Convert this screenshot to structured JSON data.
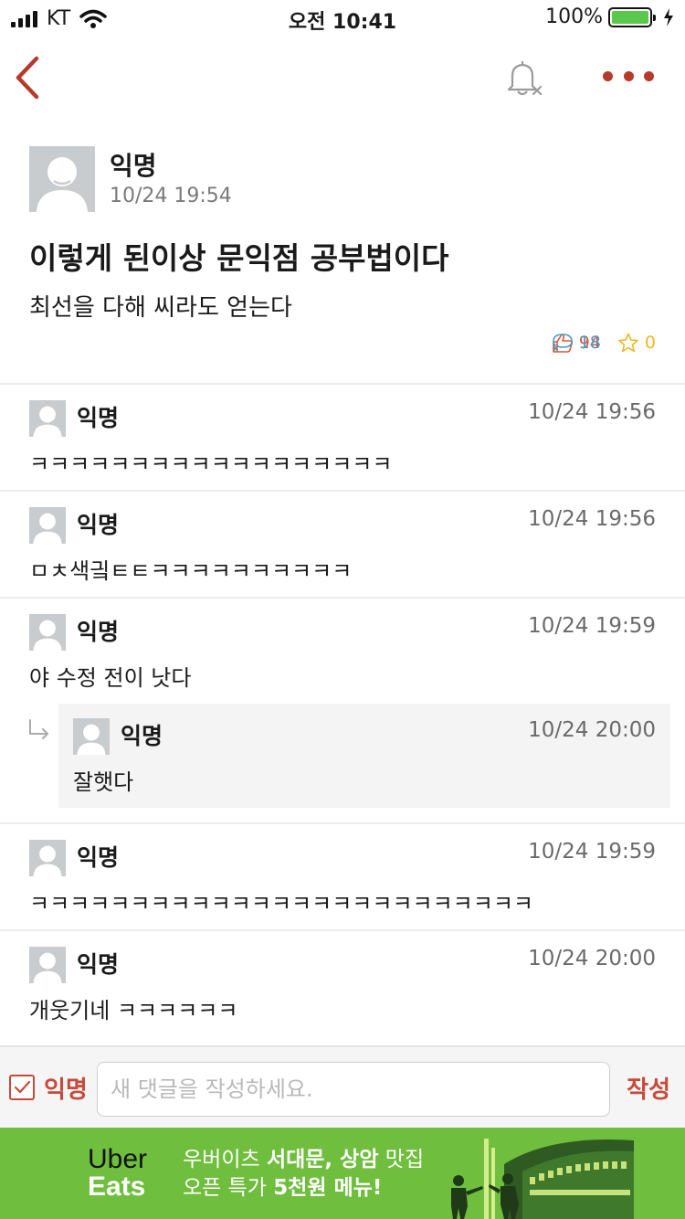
{
  "status_bar": {
    "carrier": "KT",
    "time": "오전 10:41",
    "battery": "100%"
  },
  "nav": {
    "back_icon": "chevron-left-icon",
    "notify_icon": "bell-off-icon",
    "more_icon": "more-horizontal-icon",
    "accent_color": "#b63a2a"
  },
  "post": {
    "author": "익명",
    "time": "10/24 19:54",
    "title": "이렇게 된이상 문익점 공부법이다",
    "body": "최선을 다해 씨라도 얻는다",
    "likes": "94",
    "comments": "18",
    "scraps": "0"
  },
  "comments": [
    {
      "author": "익명",
      "time": "10/24 19:56",
      "text": "ㅋㅋㅋㅋㅋㅋㅋㅋㅋㅋㅋㅋㅋㅋㅋㅋㅋㅋ"
    },
    {
      "author": "익명",
      "time": "10/24 19:56",
      "text": "ㅁㅊ색긬ㅌㅌㅋㅋㅋㅋㅋㅋㅋㅋㅋㅋ"
    },
    {
      "author": "익명",
      "time": "10/24 19:59",
      "text": "야 수정 전이 낫다",
      "reply": {
        "author": "익명",
        "time": "10/24 20:00",
        "text": "잘햇다"
      }
    },
    {
      "author": "익명",
      "time": "10/24 19:59",
      "text": "ㅋㅋㅋㅋㅋㅋㅋㅋㅋㅋㅋㅋㅋㅋㅋㅋㅋㅋㅋㅋㅋㅋㅋㅋㅋ"
    },
    {
      "author": "익명",
      "time": "10/24 20:00",
      "text": "개웃기네 ㅋㅋㅋㅋㅋㅋ"
    }
  ],
  "compose": {
    "anon_label": "익명",
    "anon_checked": true,
    "placeholder": "새 댓글을 작성하세요.",
    "submit_label": "작성"
  },
  "ad": {
    "brand_line1": "Uber",
    "brand_line2": "Eats",
    "line1_normal": "우버이츠 ",
    "line1_bold": "서대문, 상암",
    "line1_tail": " 맛집",
    "line2_normal": "오픈 특가 ",
    "line2_bold": "5천원 메뉴!",
    "background_color": "#6fbe3d"
  }
}
